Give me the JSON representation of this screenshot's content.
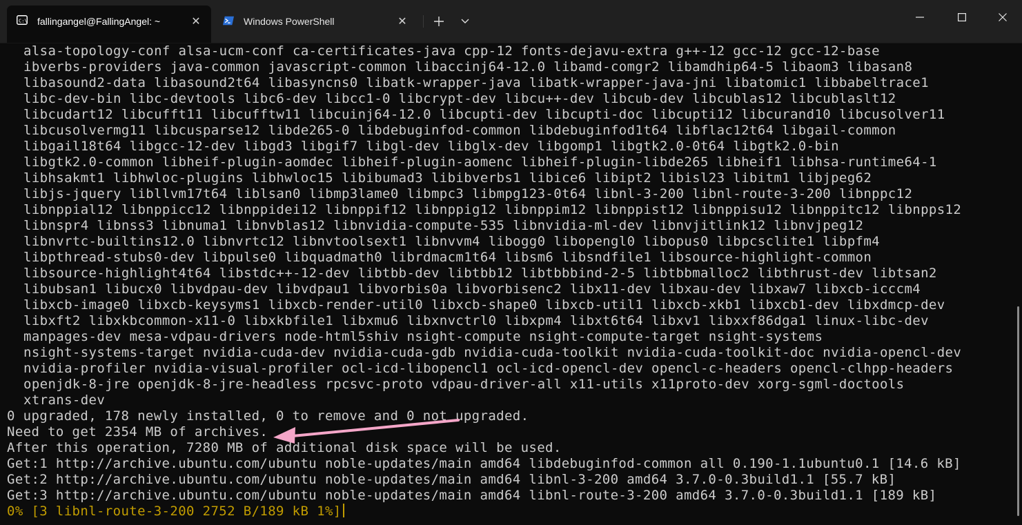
{
  "tabs": [
    {
      "label": "fallingangel@FallingAngel: ~",
      "icon": "terminal-icon",
      "active": true
    },
    {
      "label": "Windows PowerShell",
      "icon": "powershell-icon",
      "active": false
    }
  ],
  "titlebar": {
    "new_tab_glyph": "+",
    "dropdown_glyph": "⌄",
    "minimize_icon": "minimize-icon",
    "maximize_icon": "maximize-icon",
    "close_icon": "close-icon"
  },
  "terminal": {
    "package_lines": [
      "alsa-topology-conf alsa-ucm-conf ca-certificates-java cpp-12 fonts-dejavu-extra g++-12 gcc-12 gcc-12-base",
      "ibverbs-providers java-common javascript-common libaccinj64-12.0 libamd-comgr2 libamdhip64-5 libaom3 libasan8",
      "libasound2-data libasound2t64 libasyncns0 libatk-wrapper-java libatk-wrapper-java-jni libatomic1 libbabeltrace1",
      "libc-dev-bin libc-devtools libc6-dev libcc1-0 libcrypt-dev libcu++-dev libcub-dev libcublas12 libcublaslt12",
      "libcudart12 libcufft11 libcufftw11 libcuinj64-12.0 libcupti-dev libcupti-doc libcupti12 libcurand10 libcusolver11",
      "libcusolvermg11 libcusparse12 libde265-0 libdebuginfod-common libdebuginfod1t64 libflac12t64 libgail-common",
      "libgail18t64 libgcc-12-dev libgd3 libgif7 libgl-dev libglx-dev libgomp1 libgtk2.0-0t64 libgtk2.0-bin",
      "libgtk2.0-common libheif-plugin-aomdec libheif-plugin-aomenc libheif-plugin-libde265 libheif1 libhsa-runtime64-1",
      "libhsakmt1 libhwloc-plugins libhwloc15 libibumad3 libibverbs1 libice6 libipt2 libisl23 libitm1 libjpeg62",
      "libjs-jquery libllvm17t64 liblsan0 libmp3lame0 libmpc3 libmpg123-0t64 libnl-3-200 libnl-route-3-200 libnppc12",
      "libnppial12 libnppicc12 libnppidei12 libnppif12 libnppig12 libnppim12 libnppist12 libnppisu12 libnppitc12 libnpps12",
      "libnspr4 libnss3 libnuma1 libnvblas12 libnvidia-compute-535 libnvidia-ml-dev libnvjitlink12 libnvjpeg12",
      "libnvrtc-builtins12.0 libnvrtc12 libnvtoolsext1 libnvvm4 libogg0 libopengl0 libopus0 libpcsclite1 libpfm4",
      "libpthread-stubs0-dev libpulse0 libquadmath0 librdmacm1t64 libsm6 libsndfile1 libsource-highlight-common",
      "libsource-highlight4t64 libstdc++-12-dev libtbb-dev libtbb12 libtbbbind-2-5 libtbbmalloc2 libthrust-dev libtsan2",
      "libubsan1 libucx0 libvdpau-dev libvdpau1 libvorbis0a libvorbisenc2 libx11-dev libxau-dev libxaw7 libxcb-icccm4",
      "libxcb-image0 libxcb-keysyms1 libxcb-render-util0 libxcb-shape0 libxcb-util1 libxcb-xkb1 libxcb1-dev libxdmcp-dev",
      "libxft2 libxkbcommon-x11-0 libxkbfile1 libxmu6 libxnvctrl0 libxpm4 libxt6t64 libxv1 libxxf86dga1 linux-libc-dev",
      "manpages-dev mesa-vdpau-drivers node-html5shiv nsight-compute nsight-compute-target nsight-systems",
      "nsight-systems-target nvidia-cuda-dev nvidia-cuda-gdb nvidia-cuda-toolkit nvidia-cuda-toolkit-doc nvidia-opencl-dev",
      "nvidia-profiler nvidia-visual-profiler ocl-icd-libopencl1 ocl-icd-opencl-dev opencl-c-headers opencl-clhpp-headers",
      "openjdk-8-jre openjdk-8-jre-headless rpcsvc-proto vdpau-driver-all x11-utils x11proto-dev xorg-sgml-doctools",
      "xtrans-dev"
    ],
    "summary_lines": [
      "0 upgraded, 178 newly installed, 0 to remove and 0 not upgraded.",
      "Need to get 2354 MB of archives.",
      "After this operation, 7280 MB of additional disk space will be used.",
      "Get:1 http://archive.ubuntu.com/ubuntu noble-updates/main amd64 libdebuginfod-common all 0.190-1.1ubuntu0.1 [14.6 kB]",
      "Get:2 http://archive.ubuntu.com/ubuntu noble-updates/main amd64 libnl-3-200 amd64 3.7.0-0.3build1.1 [55.7 kB]",
      "Get:3 http://archive.ubuntu.com/ubuntu noble-updates/main amd64 libnl-route-3-200 amd64 3.7.0-0.3build1.1 [189 kB]"
    ],
    "progress_line": "0% [3 libnl-route-3-200 2752 B/189 kB 1%]"
  },
  "colors": {
    "background": "#0c0c0c",
    "text": "#cccccc",
    "progress": "#c19c00",
    "annotation_arrow": "#f4a6c8"
  }
}
